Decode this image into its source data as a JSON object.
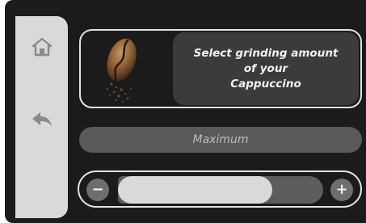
{
  "sidebar": {
    "home_icon": "home-icon",
    "back_icon": "back-arrow-icon"
  },
  "info_card": {
    "image": "coffee-bean",
    "message": "Select grinding amount\nof your\nCappuccino"
  },
  "grind_level": {
    "label": "Maximum"
  },
  "slider": {
    "minus_label": "−",
    "plus_label": "+",
    "level_fraction": 0.75
  },
  "colors": {
    "background": "#1b1b1b",
    "sidebar": "#d9d9d9",
    "panel": "#3b3b3b",
    "pill": "#595959",
    "fill": "#d9d9d9",
    "track": "#5d5d5d",
    "button": "#6e6e6e"
  }
}
